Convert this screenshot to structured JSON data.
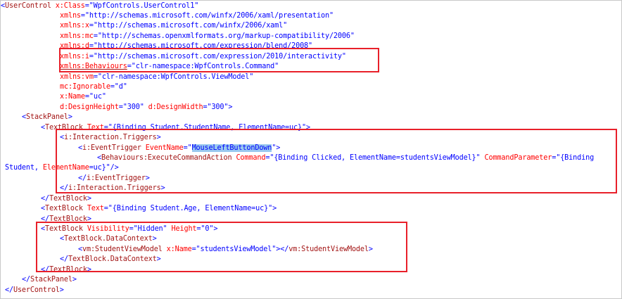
{
  "lines": [
    {
      "indent": 0,
      "parts": [
        [
          "pun",
          "<"
        ],
        [
          "tag",
          "UserControl "
        ],
        [
          "attr",
          "x:Class"
        ],
        [
          "pun",
          "=\""
        ],
        [
          "val",
          "WpfControls.UserControl1"
        ],
        [
          "pun",
          "\""
        ]
      ]
    },
    {
      "indent": 84,
      "parts": [
        [
          "attr",
          "xmlns"
        ],
        [
          "pun",
          "=\""
        ],
        [
          "val",
          "http://schemas.microsoft.com/winfx/2006/xaml/presentation"
        ],
        [
          "pun",
          "\""
        ]
      ]
    },
    {
      "indent": 84,
      "parts": [
        [
          "attr",
          "xmlns:x"
        ],
        [
          "pun",
          "=\""
        ],
        [
          "val",
          "http://schemas.microsoft.com/winfx/2006/xaml"
        ],
        [
          "pun",
          "\""
        ]
      ]
    },
    {
      "indent": 84,
      "parts": [
        [
          "attr",
          "xmlns:mc"
        ],
        [
          "pun",
          "=\""
        ],
        [
          "val",
          "http://schemas.openxmlformats.org/markup-compatibility/2006"
        ],
        [
          "pun",
          "\""
        ]
      ]
    },
    {
      "indent": 84,
      "parts": [
        [
          "attr",
          "xmlns:d"
        ],
        [
          "pun",
          "=\""
        ],
        [
          "val",
          "http://schemas.microsoft.com/expression/blend/2008"
        ],
        [
          "pun",
          "\""
        ]
      ]
    },
    {
      "indent": 84,
      "parts": [
        [
          "attr",
          "xmlns:i"
        ],
        [
          "pun",
          "=\""
        ],
        [
          "val",
          "http://schemas.microsoft.com/expression/2010/interactivity"
        ],
        [
          "pun",
          "\""
        ]
      ]
    },
    {
      "indent": 84,
      "parts": [
        [
          "attr ul",
          "xmlns:Behaviours"
        ],
        [
          "pun",
          "=\""
        ],
        [
          "val",
          "clr-namespace:WpfControls.Command"
        ],
        [
          "pun",
          "\""
        ]
      ]
    },
    {
      "indent": 84,
      "parts": [
        [
          "attr",
          "xmlns:vm"
        ],
        [
          "pun",
          "=\""
        ],
        [
          "val",
          "clr-namespace:WpfControls.ViewModel"
        ],
        [
          "pun",
          "\""
        ]
      ]
    },
    {
      "indent": 84,
      "parts": [
        [
          "attr",
          "mc:Ignorable"
        ],
        [
          "pun",
          "=\""
        ],
        [
          "val",
          "d"
        ],
        [
          "pun",
          "\""
        ]
      ]
    },
    {
      "indent": 84,
      "parts": [
        [
          "attr",
          "x:Name"
        ],
        [
          "pun",
          "=\""
        ],
        [
          "val",
          "uc"
        ],
        [
          "pun",
          "\""
        ]
      ]
    },
    {
      "indent": 84,
      "parts": [
        [
          "attr",
          "d:DesignHeight"
        ],
        [
          "pun",
          "=\""
        ],
        [
          "val",
          "300"
        ],
        [
          "pun",
          "\" "
        ],
        [
          "attr",
          "d:DesignWidth"
        ],
        [
          "pun",
          "=\""
        ],
        [
          "val",
          "300"
        ],
        [
          "pun",
          "\">"
        ]
      ]
    },
    {
      "indent": 30,
      "parts": [
        [
          "pun",
          "<"
        ],
        [
          "tag",
          "StackPanel"
        ],
        [
          "pun",
          ">"
        ]
      ]
    },
    {
      "indent": 57,
      "parts": [
        [
          "pun",
          "<"
        ],
        [
          "tag",
          "TextBlock "
        ],
        [
          "attr",
          "Text"
        ],
        [
          "pun",
          "=\""
        ],
        [
          "val",
          "{Binding Student.StudentName, ElementName=uc}"
        ],
        [
          "pun",
          "\">"
        ]
      ]
    },
    {
      "indent": 84,
      "parts": [
        [
          "pun",
          "<"
        ],
        [
          "tag",
          "i:Interaction.Triggers"
        ],
        [
          "pun",
          ">"
        ]
      ]
    },
    {
      "indent": 110,
      "parts": [
        [
          "pun",
          "<"
        ],
        [
          "tag",
          "i:EventTrigger "
        ],
        [
          "attr",
          "EventName"
        ],
        [
          "pun",
          "=\""
        ],
        [
          "val hl",
          "MouseLeftButtonDown"
        ],
        [
          "pun",
          "\">"
        ]
      ]
    },
    {
      "indent": 137,
      "parts": [
        [
          "pun",
          "<"
        ],
        [
          "tag",
          "Behaviours:ExecuteCommandAction "
        ],
        [
          "attr",
          "Command"
        ],
        [
          "pun",
          "=\""
        ],
        [
          "val",
          "{Binding Clicked, ElementName=studentsViewModel}"
        ],
        [
          "pun",
          "\" "
        ],
        [
          "attr",
          "CommandParameter"
        ],
        [
          "pun",
          "=\""
        ],
        [
          "val",
          "{Binding"
        ]
      ]
    },
    {
      "indent": 6,
      "parts": [
        [
          "val",
          "Student, "
        ],
        [
          "attr",
          "ElementName"
        ],
        [
          "val",
          "=uc}"
        ],
        [
          "pun",
          "\"/>"
        ]
      ]
    },
    {
      "indent": 110,
      "parts": [
        [
          "pun",
          "</"
        ],
        [
          "tag",
          "i:EventTrigger"
        ],
        [
          "pun",
          ">"
        ]
      ]
    },
    {
      "indent": 84,
      "parts": [
        [
          "pun",
          "</"
        ],
        [
          "tag",
          "i:Interaction.Triggers"
        ],
        [
          "pun",
          ">"
        ]
      ]
    },
    {
      "indent": 57,
      "parts": [
        [
          "pun",
          "</"
        ],
        [
          "tag",
          "TextBlock"
        ],
        [
          "pun",
          ">"
        ]
      ]
    },
    {
      "indent": 57,
      "parts": [
        [
          "pun",
          "<"
        ],
        [
          "tag",
          "TextBlock "
        ],
        [
          "attr",
          "Text"
        ],
        [
          "pun",
          "=\""
        ],
        [
          "val",
          "{Binding Student.Age, ElementName=uc}"
        ],
        [
          "pun",
          "\">"
        ]
      ]
    },
    {
      "indent": 57,
      "parts": [
        [
          "pun",
          "</"
        ],
        [
          "tag",
          "TextBlock"
        ],
        [
          "pun",
          ">"
        ]
      ]
    },
    {
      "indent": 57,
      "parts": [
        [
          "pun",
          "<"
        ],
        [
          "tag",
          "TextBlock "
        ],
        [
          "attr",
          "Visibility"
        ],
        [
          "pun",
          "=\""
        ],
        [
          "val",
          "Hidden"
        ],
        [
          "pun",
          "\" "
        ],
        [
          "attr",
          "Height"
        ],
        [
          "pun",
          "=\""
        ],
        [
          "val",
          "0"
        ],
        [
          "pun",
          "\">"
        ]
      ]
    },
    {
      "indent": 84,
      "parts": [
        [
          "pun",
          "<"
        ],
        [
          "tag",
          "TextBlock.DataContext"
        ],
        [
          "pun",
          ">"
        ]
      ]
    },
    {
      "indent": 110,
      "parts": [
        [
          "pun",
          "<"
        ],
        [
          "tag",
          "vm:StudentViewModel "
        ],
        [
          "attr",
          "x:Name"
        ],
        [
          "pun",
          "=\""
        ],
        [
          "val",
          "studentsViewModel"
        ],
        [
          "pun",
          "\"></"
        ],
        [
          "tag",
          "vm:StudentViewModel"
        ],
        [
          "pun",
          ">"
        ]
      ]
    },
    {
      "indent": 84,
      "parts": [
        [
          "pun",
          "</"
        ],
        [
          "tag",
          "TextBlock.DataContext"
        ],
        [
          "pun",
          ">"
        ]
      ]
    },
    {
      "indent": 57,
      "parts": [
        [
          "pun",
          "</"
        ],
        [
          "tag",
          "TextBlock"
        ],
        [
          "pun",
          ">"
        ]
      ]
    },
    {
      "indent": 30,
      "parts": [
        [
          "pun",
          "</"
        ],
        [
          "tag",
          "StackPanel"
        ],
        [
          "pun",
          ">"
        ]
      ]
    },
    {
      "indent": 6,
      "parts": [
        [
          "pun",
          "</"
        ],
        [
          "tag",
          "UserControl"
        ],
        [
          "pun",
          ">"
        ]
      ]
    }
  ],
  "colors": {
    "tag": "#a31515",
    "attribute": "#ff0000",
    "value": "#0000ff",
    "highlight": "#99c9ef",
    "annotation_box": "#e8202a"
  }
}
